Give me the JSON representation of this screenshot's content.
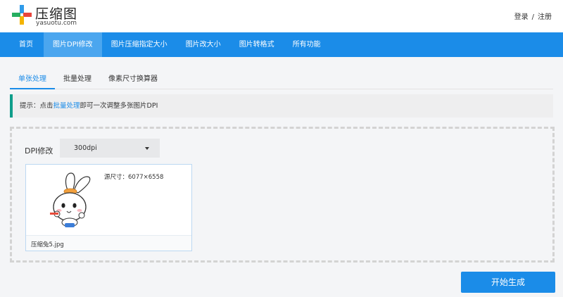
{
  "header": {
    "logo_title": "压缩图",
    "logo_sub": "yasuotu.com",
    "login": "登录",
    "separator": "/",
    "register": "注册"
  },
  "nav": {
    "items": [
      "首页",
      "图片DPI修改",
      "图片压缩指定大小",
      "图片改大小",
      "图片转格式",
      "所有功能"
    ],
    "active_index": 1
  },
  "tabs": {
    "items": [
      "单张处理",
      "批量处理",
      "像素尺寸换算器"
    ],
    "active_index": 0
  },
  "tip": {
    "prefix": "提示：点击",
    "link": "批量处理",
    "suffix": "即可一次调整多张图片DPI"
  },
  "dpi": {
    "label": "DPI修改",
    "selected": "300dpi"
  },
  "image_card": {
    "size_text": "源尺寸：6077×6558",
    "file_name": "压缩兔5.jpg"
  },
  "actions": {
    "generate": "开始生成"
  },
  "colors": {
    "nav_bg": "#1b8ce8",
    "nav_active": "#4ba6ef",
    "tip_border": "#0f9d8a",
    "link": "#1b8ce8",
    "button": "#1b8ce8"
  }
}
